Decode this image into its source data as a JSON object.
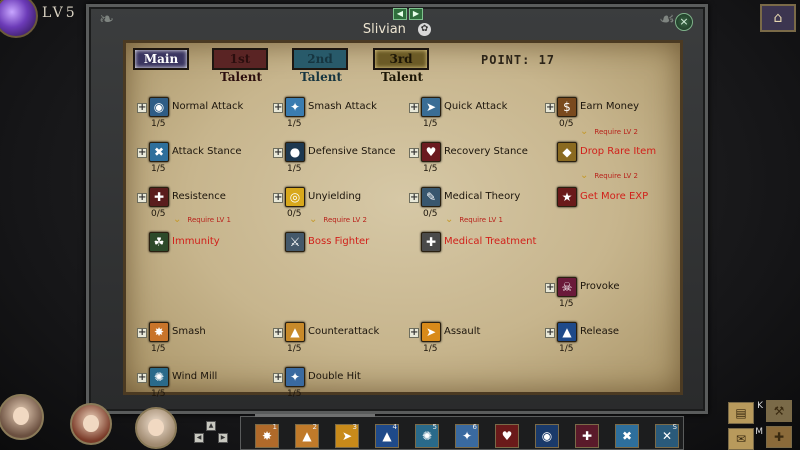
{
  "hud": {
    "level_label": "LV5",
    "map_icon": "map-scroll-icon"
  },
  "window": {
    "title": "Slivian",
    "close_symbol": "×",
    "nav_prev": "◀",
    "nav_next": "▶"
  },
  "tabs": [
    {
      "label": "Main",
      "active": true
    },
    {
      "label": "1st Talent",
      "active": false
    },
    {
      "label": "2nd Talent",
      "active": false
    },
    {
      "label": "3rd Talent",
      "active": true
    }
  ],
  "points": "POINT: 17",
  "skills": [
    {
      "name": "Normal Attack",
      "level": "1/5",
      "icon": "normal-attack-icon",
      "color": "#2f5d86",
      "glyph": "◉"
    },
    {
      "name": "Smash Attack",
      "level": "1/5",
      "icon": "smash-attack-icon",
      "color": "#3a7cb0",
      "glyph": "✦"
    },
    {
      "name": "Quick Attack",
      "level": "1/5",
      "icon": "quick-attack-icon",
      "color": "#3a6d95",
      "glyph": "➤"
    },
    {
      "name": "Earn Money",
      "level": "0/5",
      "icon": "earn-money-icon",
      "color": "#7a4a1e",
      "glyph": "$"
    },
    {
      "name": "Attack Stance",
      "level": "1/5",
      "icon": "attack-stance-icon",
      "color": "#2e6f9c",
      "glyph": "✖"
    },
    {
      "name": "Defensive Stance",
      "level": "1/5",
      "icon": "defensive-stance-icon",
      "color": "#1d3850",
      "glyph": "●"
    },
    {
      "name": "Recovery Stance",
      "level": "1/5",
      "icon": "recovery-stance-icon",
      "color": "#6b1a20",
      "glyph": "♥"
    },
    {
      "name": "Drop Rare Item",
      "level": "",
      "icon": "drop-rare-item-icon",
      "color": "#8a6a20",
      "glyph": "◆",
      "locked": true
    },
    {
      "name": "Resistence",
      "level": "0/5",
      "icon": "resistence-icon",
      "color": "#5a1d1d",
      "glyph": "✚"
    },
    {
      "name": "Unyielding",
      "level": "0/5",
      "icon": "unyielding-icon",
      "color": "#d8a81c",
      "glyph": "◎"
    },
    {
      "name": "Medical Theory",
      "level": "0/5",
      "icon": "medical-theory-icon",
      "color": "#38566e",
      "glyph": "✎"
    },
    {
      "name": "Get More EXP",
      "level": "",
      "icon": "get-more-exp-icon",
      "color": "#6a1a1a",
      "glyph": "★",
      "locked": true
    },
    {
      "name": "Immunity",
      "level": "",
      "icon": "immunity-icon",
      "color": "#2c4a2a",
      "glyph": "☘",
      "locked": true
    },
    {
      "name": "Boss Fighter",
      "level": "",
      "icon": "boss-fighter-icon",
      "color": "#44586a",
      "glyph": "⚔",
      "locked": true
    },
    {
      "name": "Medical Treatment",
      "level": "",
      "icon": "medical-treatment-icon",
      "color": "#4a4a4a",
      "glyph": "✚",
      "locked": true
    },
    {
      "name": "Provoke",
      "level": "1/5",
      "icon": "provoke-icon",
      "color": "#6a1a3a",
      "glyph": "☠"
    },
    {
      "name": "Smash",
      "level": "1/5",
      "icon": "smash-icon",
      "color": "#c8742a",
      "glyph": "✸"
    },
    {
      "name": "Counterattack",
      "level": "1/5",
      "icon": "counterattack-icon",
      "color": "#c88a2a",
      "glyph": "▲"
    },
    {
      "name": "Assault",
      "level": "1/5",
      "icon": "assault-icon",
      "color": "#d88a1a",
      "glyph": "➤"
    },
    {
      "name": "Release",
      "level": "1/5",
      "icon": "release-icon",
      "color": "#1f4a8a",
      "glyph": "▲"
    },
    {
      "name": "Wind Mill",
      "level": "1/5",
      "icon": "wind-mill-icon",
      "color": "#2a6a8a",
      "glyph": "✺"
    },
    {
      "name": "Double Hit",
      "level": "1/5",
      "icon": "double-hit-icon",
      "color": "#3a6aa0",
      "glyph": "✦"
    }
  ],
  "requirements": [
    {
      "text": "Require LV 1"
    },
    {
      "text": "Require LV 2"
    },
    {
      "text": "Require LV 1"
    },
    {
      "text": "Require LV 2"
    },
    {
      "text": "Require LV 2"
    }
  ],
  "skillbar": {
    "slots": [
      {
        "key": "1",
        "icon": "smash-slot-icon",
        "color": "#b06a2a",
        "glyph": "✸"
      },
      {
        "key": "2",
        "icon": "counterattack-slot-icon",
        "color": "#c07a2a",
        "glyph": "▲"
      },
      {
        "key": "3",
        "icon": "assault-slot-icon",
        "color": "#c88a1a",
        "glyph": "➤"
      },
      {
        "key": "4",
        "icon": "release-slot-icon",
        "color": "#1f4a8a",
        "glyph": "▲"
      },
      {
        "key": "5",
        "icon": "wind-mill-slot-icon",
        "color": "#2a6a8a",
        "glyph": "✺"
      },
      {
        "key": "6",
        "icon": "double-hit-slot-icon",
        "color": "#3a6aa0",
        "glyph": "✦"
      },
      {
        "key": "",
        "icon": "health-potion-icon",
        "color": "#6a1a1a",
        "glyph": "♥"
      },
      {
        "key": "",
        "icon": "mana-potion-icon",
        "color": "#1a3a6a",
        "glyph": "◉"
      },
      {
        "key": "",
        "icon": "elixir-icon",
        "color": "#5a1a2a",
        "glyph": "✚"
      },
      {
        "key": "",
        "icon": "attack-stance-slot-icon",
        "color": "#2e6f9c",
        "glyph": "✖"
      },
      {
        "key": "S",
        "icon": "cross-slash-slot-icon",
        "color": "#2a5a7a",
        "glyph": "✕"
      }
    ]
  },
  "right_menu": [
    {
      "hotkey": "K",
      "icon": "skill-book-icon"
    },
    {
      "hotkey": "M",
      "icon": "map-icon"
    }
  ]
}
